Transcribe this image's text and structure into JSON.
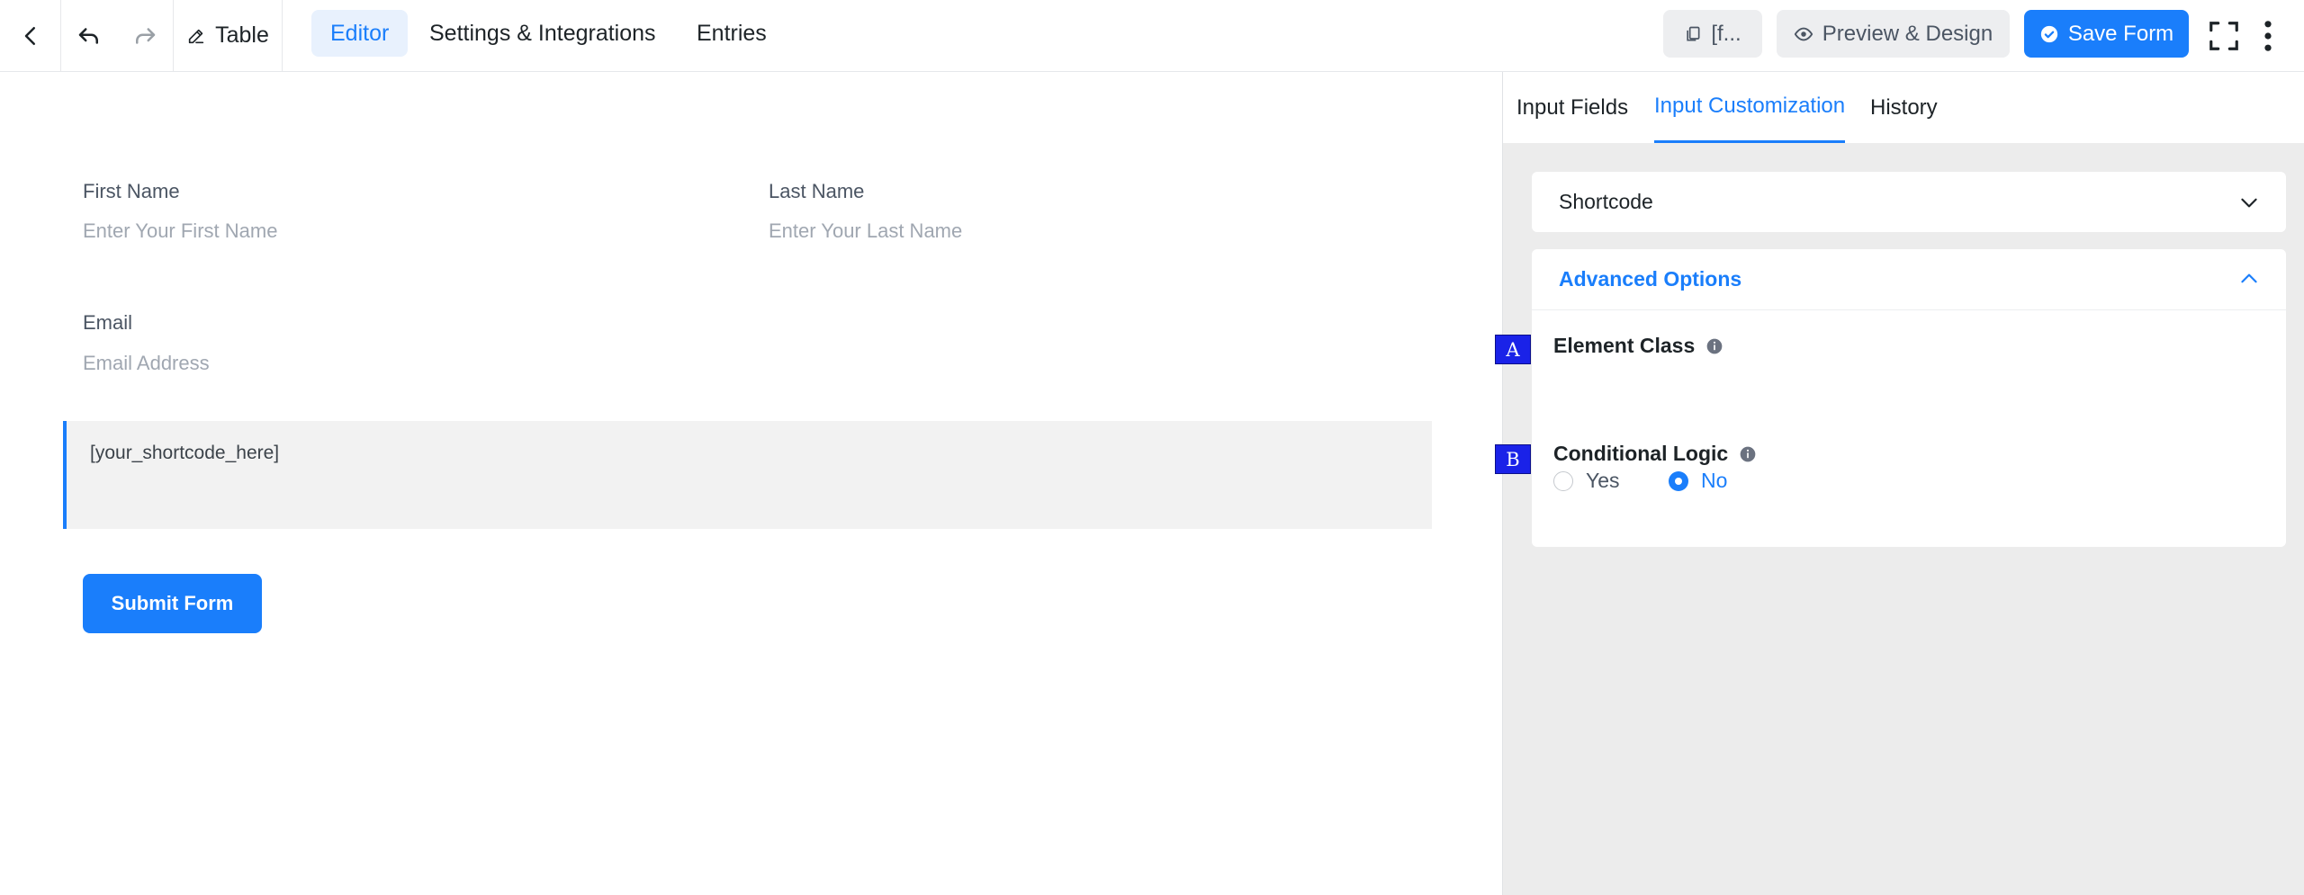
{
  "topbar": {
    "form_title": "Table",
    "nav_tabs": [
      "Editor",
      "Settings & Integrations",
      "Entries"
    ],
    "active_tab": "Editor",
    "shortcode_btn_label": "[f...",
    "preview_btn_label": "Preview & Design",
    "save_btn_label": "Save Form"
  },
  "form": {
    "first_name_label": "First Name",
    "first_name_placeholder": "Enter Your First Name",
    "last_name_label": "Last Name",
    "last_name_placeholder": "Enter Your Last Name",
    "email_label": "Email",
    "email_placeholder": "Email Address",
    "shortcode_content": "[your_shortcode_here]",
    "submit_label": "Submit Form"
  },
  "sidebar": {
    "tabs": [
      "Input Fields",
      "Input Customization",
      "History"
    ],
    "active_tab": "Input Customization",
    "shortcode_section": "Shortcode",
    "advanced_section": "Advanced Options",
    "element_class_label": "Element Class",
    "conditional_logic_label": "Conditional Logic",
    "radio_yes": "Yes",
    "radio_no": "No",
    "conditional_logic_value": "No"
  },
  "markers": [
    "A",
    "B"
  ],
  "colors": {
    "accent": "#1a7efb",
    "marker": "#1a22e8"
  }
}
